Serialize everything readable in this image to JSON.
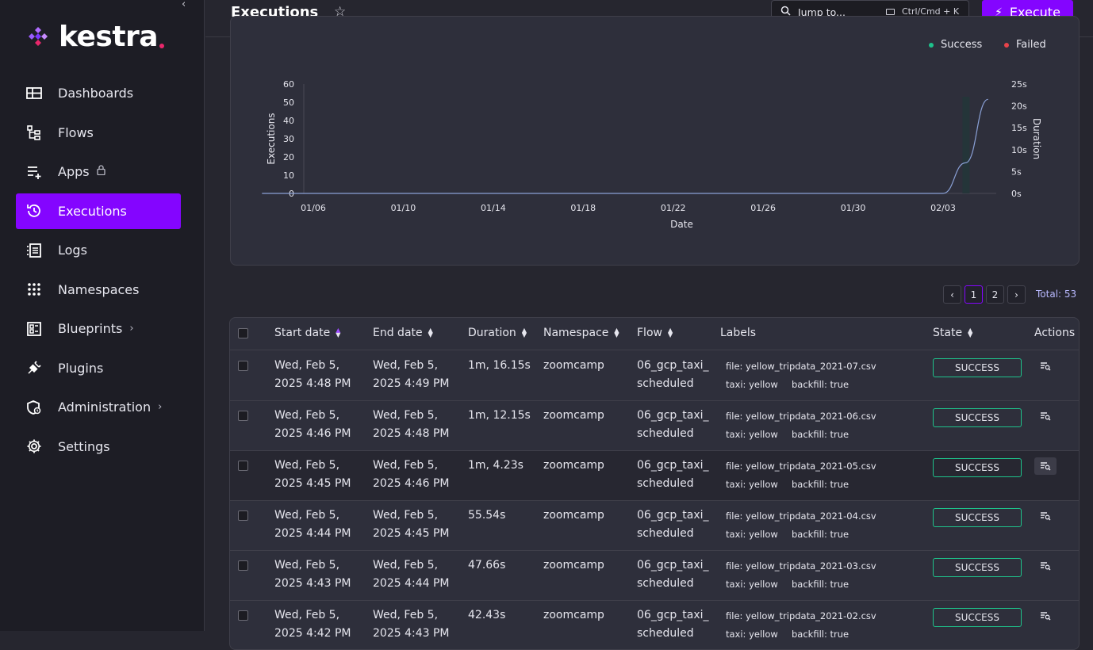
{
  "app": {
    "logo_text": "kestra"
  },
  "sidebar": {
    "items": [
      {
        "label": "Dashboards",
        "icon": "dashboard-icon"
      },
      {
        "label": "Flows",
        "icon": "flow-tree-icon"
      },
      {
        "label": "Apps",
        "icon": "apps-list-icon",
        "extra": "lock-icon"
      },
      {
        "label": "Executions",
        "icon": "history-clock-icon",
        "active": true
      },
      {
        "label": "Logs",
        "icon": "logs-list-icon"
      },
      {
        "label": "Namespaces",
        "icon": "grid-dots-icon"
      },
      {
        "label": "Blueprints",
        "icon": "blueprint-icon",
        "extra": "chevron-right-icon"
      },
      {
        "label": "Plugins",
        "icon": "plug-icon"
      },
      {
        "label": "Administration",
        "icon": "admin-shield-icon",
        "extra": "chevron-right-icon"
      },
      {
        "label": "Settings",
        "icon": "gear-icon"
      }
    ]
  },
  "header": {
    "title": "Executions",
    "jump_placeholder": "Jump to...",
    "shortcut": "Ctrl/Cmd + K",
    "execute_label": "Execute"
  },
  "chart_data": {
    "type": "line",
    "legend": [
      "Success",
      "Failed"
    ],
    "legend_colors": {
      "Success": "#1ec28b",
      "Failed": "#e8434a"
    },
    "xlabel": "Date",
    "ylabel_left": "Executions",
    "ylabel_right": "Duration",
    "x_ticks": [
      "01/06",
      "01/10",
      "01/14",
      "01/18",
      "01/22",
      "01/26",
      "01/30",
      "02/03"
    ],
    "y_left_ticks": [
      "0",
      "10",
      "20",
      "30",
      "40",
      "50",
      "60"
    ],
    "y_right_ticks": [
      "0s",
      "5s",
      "10s",
      "15s",
      "20s",
      "25s"
    ],
    "y_left_range": [
      0,
      60
    ],
    "y_right_range": [
      0,
      25
    ],
    "series": [
      {
        "name": "Success",
        "dates": [
          "01/04",
          "01/05",
          "02/04"
        ],
        "values": [
          0,
          0,
          53
        ]
      },
      {
        "name": "Duration",
        "dates": [
          "01/04",
          "02/03",
          "02/04",
          "02/05"
        ],
        "values": [
          0,
          0,
          7,
          21.5
        ]
      }
    ]
  },
  "pagination": {
    "pages": [
      "1",
      "2"
    ],
    "current": "1",
    "total": "Total: 53",
    "prev": "‹",
    "next": "›"
  },
  "table": {
    "columns": [
      "Start date",
      "End date",
      "Duration",
      "Namespace",
      "Flow",
      "Labels",
      "State",
      "Actions"
    ],
    "rows": [
      {
        "start": [
          "Wed, Feb 5,",
          "2025 4:48 PM"
        ],
        "end": [
          "Wed, Feb 5,",
          "2025 4:49 PM"
        ],
        "duration": "1m, 16.15s",
        "namespace": "zoomcamp",
        "flow": [
          "06_gcp_taxi_",
          "scheduled"
        ],
        "label_file": "file: yellow_tripdata_2021-07.csv",
        "label_taxi": "taxi: yellow",
        "label_backfill": "backfill: true",
        "state": "SUCCESS"
      },
      {
        "start": [
          "Wed, Feb 5,",
          "2025 4:46 PM"
        ],
        "end": [
          "Wed, Feb 5,",
          "2025 4:48 PM"
        ],
        "duration": "1m, 12.15s",
        "namespace": "zoomcamp",
        "flow": [
          "06_gcp_taxi_",
          "scheduled"
        ],
        "label_file": "file: yellow_tripdata_2021-06.csv",
        "label_taxi": "taxi: yellow",
        "label_backfill": "backfill: true",
        "state": "SUCCESS"
      },
      {
        "start": [
          "Wed, Feb 5,",
          "2025 4:45 PM"
        ],
        "end": [
          "Wed, Feb 5,",
          "2025 4:46 PM"
        ],
        "duration": "1m, 4.23s",
        "namespace": "zoomcamp",
        "flow": [
          "06_gcp_taxi_",
          "scheduled"
        ],
        "label_file": "file: yellow_tripdata_2021-05.csv",
        "label_taxi": "taxi: yellow",
        "label_backfill": "backfill: true",
        "state": "SUCCESS"
      },
      {
        "start": [
          "Wed, Feb 5,",
          "2025 4:44 PM"
        ],
        "end": [
          "Wed, Feb 5,",
          "2025 4:45 PM"
        ],
        "duration": "55.54s",
        "namespace": "zoomcamp",
        "flow": [
          "06_gcp_taxi_",
          "scheduled"
        ],
        "label_file": "file: yellow_tripdata_2021-04.csv",
        "label_taxi": "taxi: yellow",
        "label_backfill": "backfill: true",
        "state": "SUCCESS"
      },
      {
        "start": [
          "Wed, Feb 5,",
          "2025 4:43 PM"
        ],
        "end": [
          "Wed, Feb 5,",
          "2025 4:44 PM"
        ],
        "duration": "47.66s",
        "namespace": "zoomcamp",
        "flow": [
          "06_gcp_taxi_",
          "scheduled"
        ],
        "label_file": "file: yellow_tripdata_2021-03.csv",
        "label_taxi": "taxi: yellow",
        "label_backfill": "backfill: true",
        "state": "SUCCESS"
      },
      {
        "start": [
          "Wed, Feb 5,",
          "2025 4:42 PM"
        ],
        "end": [
          "Wed, Feb 5,",
          "2025 4:43 PM"
        ],
        "duration": "42.43s",
        "namespace": "zoomcamp",
        "flow": [
          "06_gcp_taxi_",
          "scheduled"
        ],
        "label_file": "file: yellow_tripdata_2021-02.csv",
        "label_taxi": "taxi: yellow",
        "label_backfill": "backfill: true",
        "state": "SUCCESS"
      }
    ]
  },
  "colors": {
    "accent": "#8405ff",
    "success": "#1ec28b",
    "sidebar_bg": "#1d1d25",
    "page_bg": "#26262f"
  }
}
